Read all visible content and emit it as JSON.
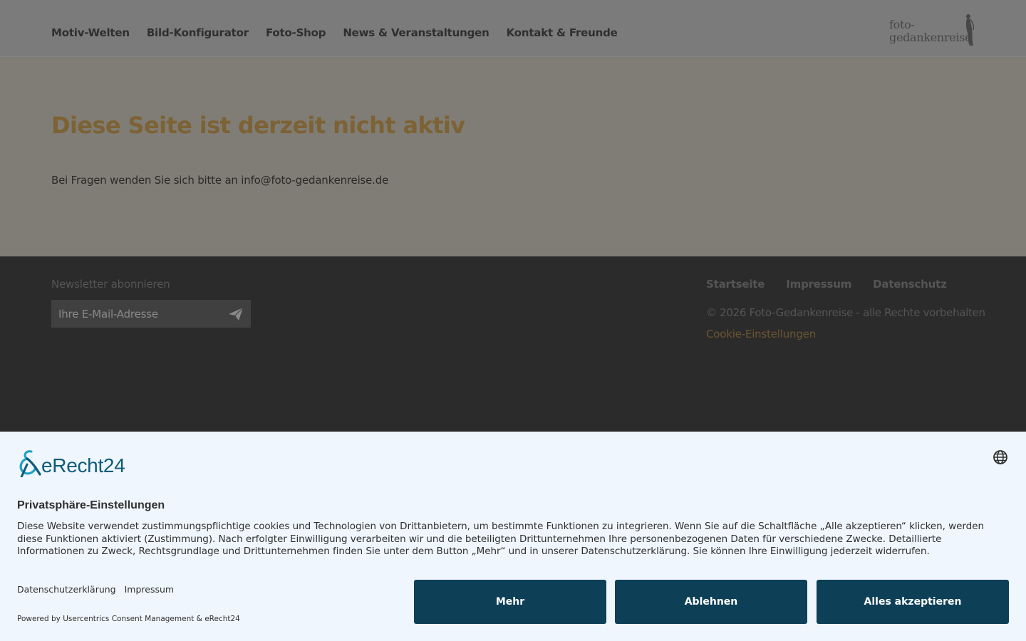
{
  "header": {
    "nav": [
      "Motiv-Welten",
      "Bild-Konfigurator",
      "Foto-Shop",
      "News & Veranstaltungen",
      "Kontakt & Freunde"
    ],
    "logo_line1": "foto-",
    "logo_line2": "gedankenreise"
  },
  "main": {
    "title": "Diese Seite ist derzeit nicht aktiv",
    "text": "Bei Fragen wenden Sie sich bitte an info@foto-gedankenreise.de"
  },
  "footer": {
    "newsletter_label": "Newsletter abonnieren",
    "email_placeholder": "Ihre E-Mail-Adresse",
    "links": [
      "Startseite",
      "Impressum",
      "Datenschutz"
    ],
    "copyright": "© 2026 Foto-Gedankenreise - alle Rechte vorbehalten",
    "cookie_settings": "Cookie-Einstellungen"
  },
  "consent": {
    "brand": "eRecht24",
    "title": "Privatsphäre-Einstellungen",
    "text": "Diese Website verwendet zustimmungspflichtige cookies und Technologien von Drittanbietern, um bestimmte Funktionen zu integrieren. Wenn Sie auf die Schaltfläche „Alle akzeptieren“ klicken, werden diese Funktionen aktiviert (Zustimmung). Nach erfolgter Einwilligung verarbeiten wir und die beteiligten Drittunternehmen Ihre personenbezogenen Daten für verschiedene Zwecke. Detaillierte Informationen zu Zweck, Rechtsgrundlage und Drittunternehmen finden Sie unter dem Button „Mehr“ und in unserer Datenschutzerklärung. Sie können Ihre Einwilligung jederzeit widerrufen.",
    "link_privacy": "Datenschutzerklärung",
    "link_imprint": "Impressum",
    "powered_by": "Powered by Usercentrics Consent Management & eRecht24",
    "btn_more": "Mehr",
    "btn_deny": "Ablehnen",
    "btn_accept": "Alles akzeptieren"
  },
  "colors": {
    "accent_gold": "#7c6234",
    "consent_button": "#0d4057",
    "erecht_brand": "#0d5d78"
  },
  "icons": {
    "send": "paper-plane-icon",
    "language": "globe-icon"
  }
}
